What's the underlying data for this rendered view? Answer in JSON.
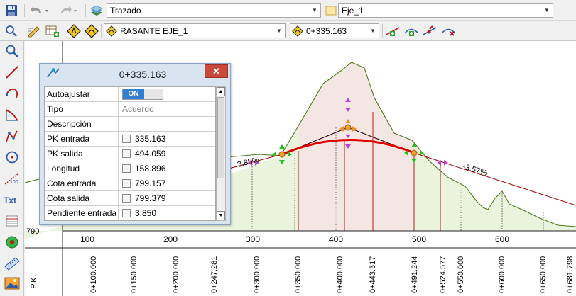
{
  "toolbar": {
    "layer_combo": "Trazado",
    "axis_combo": "Eje_1",
    "profile_combo": "RASANTE EJE_1",
    "station_combo": "0+335.163"
  },
  "colors": {
    "terrain": "#4a7a1a",
    "terrain_fill": "#e9f2dc",
    "grade_line": "#a00000",
    "vertical_curve": "#e00000",
    "handle_green": "#22c022",
    "handle_pink": "#c040d0",
    "handle_orange": "#f09020",
    "panel_close": "#c74a3c",
    "toggle_on": "#2f7fd3"
  },
  "left_tools": [
    "zoom-icon",
    "line-icon",
    "arc-icon",
    "clothoid-icon",
    "polyline-icon",
    "circle-icon",
    "dimension-icon",
    "text-icon",
    "table-icon",
    "point-icon",
    "ruler-icon",
    "image-icon"
  ],
  "canvas": {
    "slope_left": "3.85%",
    "slope_right": "-3.57%",
    "elev_label": "790",
    "axis_x_labels": [
      "100",
      "200",
      "300",
      "400",
      "500",
      "600"
    ],
    "pk_label": "P.K.",
    "stations": [
      "0+100.000",
      "0+150.000",
      "0+200.000",
      "0+247.281",
      "0+300.000",
      "0+350.000",
      "0+400.000",
      "0+443.317",
      "0+491.244",
      "0+524.577",
      "0+550.000",
      "0+600.000",
      "0+650.000",
      "0+681.798"
    ]
  },
  "panel": {
    "title": "0+335.163",
    "close": "✕",
    "rows": [
      {
        "label": "Autoajustar",
        "value": "ON"
      },
      {
        "label": "Tipo",
        "value": "Acuerdo"
      },
      {
        "label": "Descripción",
        "value": ""
      },
      {
        "label": "PK entrada",
        "value": "335.163"
      },
      {
        "label": "PK salida",
        "value": "494.059"
      },
      {
        "label": "Longitud",
        "value": "158.896"
      },
      {
        "label": "Cota entrada",
        "value": "799.157"
      },
      {
        "label": "Cota salida",
        "value": "799.379"
      },
      {
        "label": "Pendiente entrada",
        "value": "3.850"
      }
    ]
  }
}
